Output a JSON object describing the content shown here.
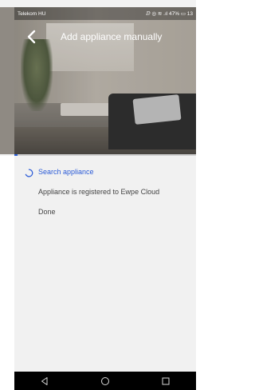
{
  "status_bar": {
    "carrier": "Telekom HU",
    "indicators": "ⅅ ◎ ≋ .ıl 47% ▭ 13"
  },
  "header": {
    "title": "Add appliance manually"
  },
  "steps": [
    {
      "label": "Search appliance",
      "state": "in-progress"
    },
    {
      "label": "Appliance is registered to Ewpe Cloud",
      "state": "pending"
    },
    {
      "label": "Done",
      "state": "pending"
    }
  ],
  "colors": {
    "accent": "#2b5bd7",
    "text_secondary": "#444444",
    "content_bg": "#f1f1f1",
    "nav_bg": "#000000"
  },
  "icons": {
    "back": "back-arrow-icon",
    "spinner": "loading-spinner-icon",
    "nav_back": "nav-back-icon",
    "nav_home": "nav-home-icon",
    "nav_recents": "nav-recents-icon"
  }
}
